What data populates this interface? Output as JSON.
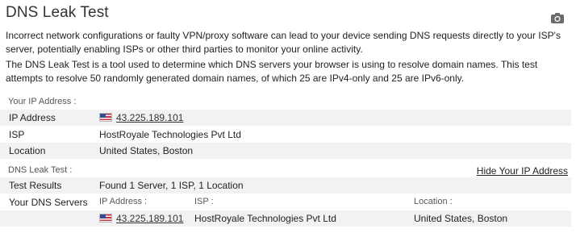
{
  "header": {
    "title": "DNS Leak Test",
    "camera_icon": "camera-icon"
  },
  "intro": {
    "paragraph1": "Incorrect network configurations or faulty VPN/proxy software can lead to your device sending DNS requests directly to your ISP's server, potentially enabling ISPs or other third parties to monitor your online activity.",
    "paragraph2": "The DNS Leak Test is a tool used to determine which DNS servers your browser is using to resolve domain names. This test attempts to resolve 50 randomly generated domain names, of which 25 are IPv4-only and 25 are IPv6-only."
  },
  "ip_section": {
    "label": "Your IP Address :",
    "rows": [
      {
        "key": "IP Address",
        "value": "43.225.189.101",
        "flag": "us-flag-icon"
      },
      {
        "key": "ISP",
        "value": "HostRoyale Technologies Pvt Ltd"
      },
      {
        "key": "Location",
        "value": "United States, Boston"
      }
    ]
  },
  "dns_section": {
    "label": "DNS Leak Test :",
    "hide_link": "Hide Your IP Address",
    "results_key": "Test Results",
    "results_value": "Found 1 Server, 1 ISP, 1 Location",
    "servers_key": "Your DNS Servers",
    "columns": {
      "ip": "IP Address :",
      "isp": "ISP :",
      "location": "Location :"
    },
    "servers": [
      {
        "ip": "43.225.189.101",
        "isp": "HostRoyale Technologies Pvt Ltd",
        "location": "United States, Boston",
        "flag": "us-flag-icon"
      }
    ]
  }
}
